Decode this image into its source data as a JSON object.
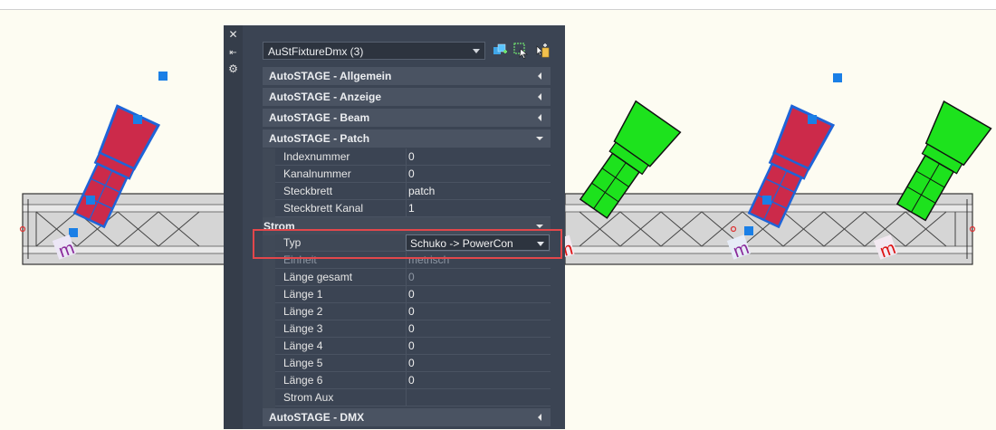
{
  "panel": {
    "selector_value": "AuStFixtureDmx (3)",
    "strip": {
      "close": "✕",
      "pin": "⇤",
      "settings": "⚙"
    },
    "sections": [
      {
        "label": "AutoSTAGE - Allgemein",
        "state": "collapsed"
      },
      {
        "label": "AutoSTAGE - Anzeige",
        "state": "collapsed"
      },
      {
        "label": "AutoSTAGE - Beam",
        "state": "collapsed"
      },
      {
        "label": "AutoSTAGE - Patch",
        "state": "expanded"
      },
      {
        "label": "AutoSTAGE - DMX",
        "state": "collapsed"
      }
    ],
    "patch_rows": [
      {
        "label": "Indexnummer",
        "value": "0"
      },
      {
        "label": "Kanalnummer",
        "value": "0"
      },
      {
        "label": "Steckbrett",
        "value": "patch"
      },
      {
        "label": "Steckbrett Kanal",
        "value": "1"
      }
    ],
    "strom_group": "Strom",
    "typ": {
      "label": "Typ",
      "value": "Schuko -> PowerCon"
    },
    "strom_rows": [
      {
        "label": "Einheit",
        "value": "metrisch"
      },
      {
        "label": "Länge gesamt",
        "value": "0"
      },
      {
        "label": "Länge 1",
        "value": "0"
      },
      {
        "label": "Länge 2",
        "value": "0"
      },
      {
        "label": "Länge 3",
        "value": "0"
      },
      {
        "label": "Länge 4",
        "value": "0"
      },
      {
        "label": "Länge 5",
        "value": "0"
      },
      {
        "label": "Länge 6",
        "value": "0"
      },
      {
        "label": "Strom Aux",
        "value": ""
      }
    ]
  },
  "drawing": {
    "fixture_label": "m",
    "colors": {
      "selected_fixture": "#cc2a4a",
      "unselected_fixture": "#1de21d",
      "selection_blue": "#1e64d8",
      "grip": "#1a7fe6",
      "truss": "#cfcfcf",
      "highlight": "#e2474b"
    }
  },
  "icons": [
    "close-icon",
    "pin-icon",
    "settings-icon",
    "quick-select-icon",
    "select-objects-icon",
    "toggle-pickadd-icon"
  ]
}
